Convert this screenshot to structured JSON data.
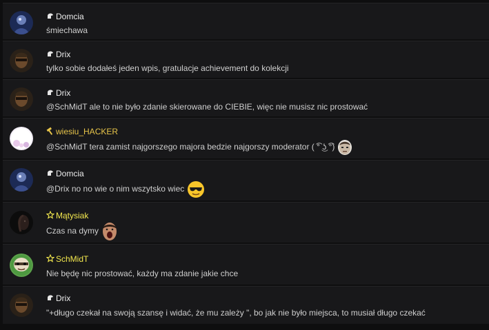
{
  "colors": {
    "background": "#0e0e0f",
    "row_background": "#18181a",
    "text": "#cfcfcf",
    "name_default": "#ececec",
    "name_hacker": "#e8c54a",
    "name_star": "#f3e84e"
  },
  "messages": [
    {
      "author": "Domcia",
      "badge_icon": "helmet-icon",
      "avatar_icon": "domcia-avatar",
      "text": "śmiechawa"
    },
    {
      "author": "Drix",
      "badge_icon": "helmet-icon",
      "avatar_icon": "drix-avatar",
      "text": "tylko sobie dodałeś jeden wpis, gratulacje achievement do kolekcji"
    },
    {
      "author": "Drix",
      "badge_icon": "helmet-icon",
      "avatar_icon": "drix-avatar",
      "text": "@SchMidT ale to nie było zdanie skierowane do CIEBIE, więc nie musisz nic prostować"
    },
    {
      "author": "wiesiu_HACKER",
      "badge_icon": "hammer-icon",
      "avatar_icon": "wiesiu-avatar",
      "text": "@SchMidT tera zamist najgorszego majora bedzie najgorszy moderator ( ͡° ͜ʖ ͡°)",
      "emoji_icon": "face-emote-icon"
    },
    {
      "author": "Domcia",
      "badge_icon": "helmet-icon",
      "avatar_icon": "domcia-avatar",
      "text": "@Drix no no wie o nim wszytsko wiec",
      "emoji_icon": "sunglasses-emoji-icon"
    },
    {
      "author": "Mątysiak",
      "badge_icon": "star-outline-icon",
      "avatar_icon": "matysiak-avatar",
      "text": "Czas na dymy",
      "emoji_icon": "shouting-face-emote-icon"
    },
    {
      "author": "SchMidT",
      "badge_icon": "star-outline-icon",
      "avatar_icon": "schmidt-avatar",
      "text": "Nie będę nic prostować, każdy ma zdanie jakie chce"
    },
    {
      "author": "Drix",
      "badge_icon": "helmet-icon",
      "avatar_icon": "drix-avatar",
      "text": "\"+długo czekał na swoją szansę i widać, że mu zależy \", bo jak nie było miejsca, to musiał długo czekać"
    }
  ]
}
